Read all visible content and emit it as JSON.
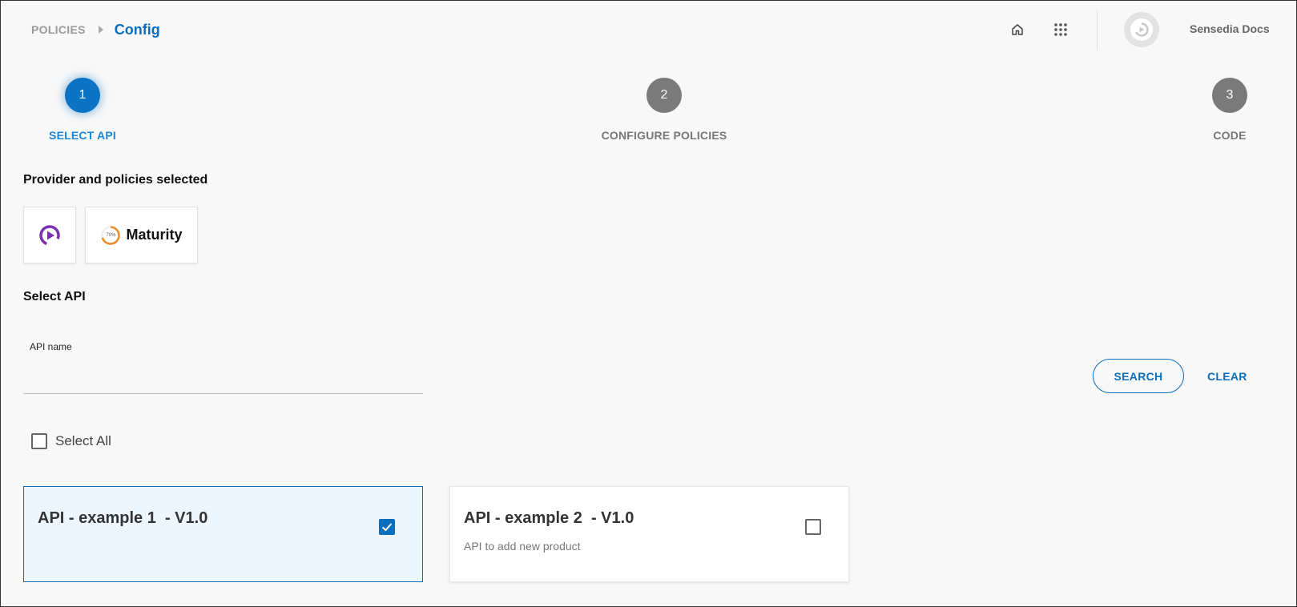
{
  "breadcrumb": {
    "parent": "POLICIES",
    "current": "Config"
  },
  "header": {
    "user_name": "Sensedia Docs",
    "icons": [
      "home-icon",
      "apps-grid-icon"
    ]
  },
  "stepper": [
    {
      "number": "1",
      "label": "SELECT API",
      "active": true
    },
    {
      "number": "2",
      "label": "CONFIGURE POLICIES",
      "active": false
    },
    {
      "number": "3",
      "label": "CODE",
      "active": false
    }
  ],
  "provider_section": {
    "title": "Provider and policies selected",
    "maturity": {
      "label": "Maturity",
      "percent": "70%"
    }
  },
  "select_section": {
    "title": "Select API",
    "input_label": "API name",
    "input_value": "",
    "search_label": "SEARCH",
    "clear_label": "CLEAR",
    "select_all_label": "Select All",
    "select_all_checked": false
  },
  "apis": [
    {
      "title": "API - example 1  - V1.0",
      "description": "",
      "checked": true
    },
    {
      "title": "API - example 2  - V1.0",
      "description": "API to add new product",
      "checked": false
    }
  ],
  "colors": {
    "primary": "#0a6ebd",
    "step_inactive": "#7a7a7a",
    "maturity": "#f08a24",
    "provider": "#7b2fb0"
  }
}
